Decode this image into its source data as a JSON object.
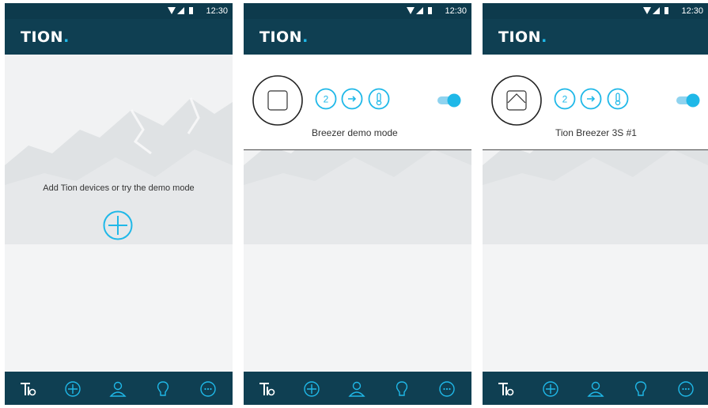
{
  "status_time": "12:30",
  "brand": {
    "logo_text": "TION",
    "accent": "#1fb8e8",
    "dark": "#0f3f52"
  },
  "screen1": {
    "empty_message": "Add Tion devices or try the demo mode"
  },
  "screen2": {
    "device_name": "Breezer demo mode",
    "speed": "2",
    "device_state": "closed-square"
  },
  "screen3": {
    "device_name": "Tion Breezer 3S #1",
    "speed": "2",
    "device_state": "open-flap"
  },
  "bottom_nav": [
    "tion-home-icon",
    "add-icon",
    "profile-icon",
    "idea-icon",
    "chat-icon"
  ]
}
